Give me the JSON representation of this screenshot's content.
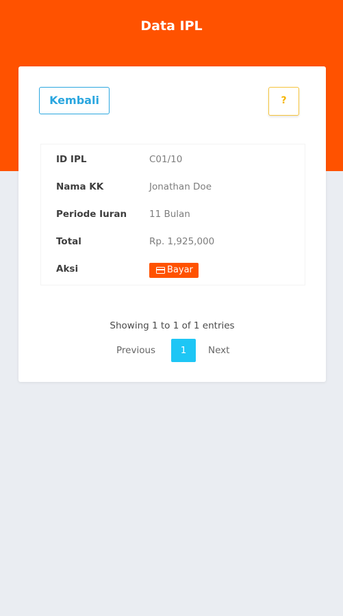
{
  "header": {
    "title": "Data IPL"
  },
  "toolbar": {
    "back_label": "Kembali",
    "help_label": "?"
  },
  "detail": {
    "rows": [
      {
        "label": "ID IPL",
        "value": "C01/10"
      },
      {
        "label": "Nama KK",
        "value": "Jonathan Doe"
      },
      {
        "label": "Periode Iuran",
        "value": "11 Bulan"
      },
      {
        "label": "Total",
        "value": "Rp. 1,925,000"
      },
      {
        "label": "Aksi",
        "value": ""
      }
    ],
    "pay_label": "Bayar",
    "pay_icon": "credit-card-icon"
  },
  "table_info": "Showing 1 to 1 of 1 entries",
  "pagination": {
    "previous": "Previous",
    "current": "1",
    "next": "Next"
  },
  "colors": {
    "brand": "#ff5200",
    "back_button": "#2aa6df",
    "help_button": "#f5c33b",
    "active_page": "#1ec6f5",
    "background": "#eaedf2"
  }
}
